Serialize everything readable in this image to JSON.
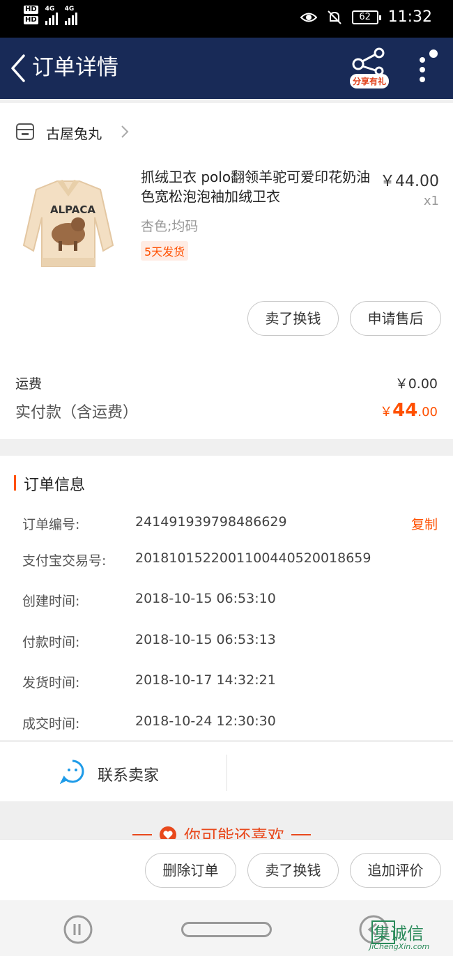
{
  "statusbar": {
    "hd1": "HD",
    "hd2": "HD",
    "net1": "4G",
    "net2": "4G",
    "battery": "62",
    "time": "11:32"
  },
  "header": {
    "title": "订单详情",
    "share_badge": "分享有礼"
  },
  "shop": {
    "name": "古屋兔丸"
  },
  "product": {
    "title": "抓绒卫衣 polo翻领羊驼可爱印花奶油色宽松泡泡袖加绒卫衣",
    "price": "￥44.00",
    "qty": "x1",
    "sku": "杏色;均码",
    "ship_tag": "5天发货",
    "print_text": "ALPACA",
    "buttons": [
      "卖了换钱",
      "申请售后"
    ]
  },
  "fees": {
    "freight_label": "运费",
    "freight_value": "￥0.00",
    "total_label": "实付款（含运费）",
    "total_symbol": "￥",
    "total_int": "44",
    "total_dec": ".00"
  },
  "order_info": {
    "title": "订单信息",
    "copy_label": "复制",
    "rows": [
      {
        "label": "订单编号:",
        "value": "241491939798486629"
      },
      {
        "label": "支付宝交易号:",
        "value": "2018101522001100440520018659"
      },
      {
        "label": "创建时间:",
        "value": "2018-10-15 06:53:10"
      },
      {
        "label": "付款时间:",
        "value": "2018-10-15 06:53:13"
      },
      {
        "label": "发货时间:",
        "value": "2018-10-17 14:32:21"
      },
      {
        "label": "成交时间:",
        "value": "2018-10-24 12:30:30"
      }
    ]
  },
  "contact": {
    "label": "联系卖家"
  },
  "teaser": {
    "text": "你可能还喜欢"
  },
  "actions": {
    "buttons": [
      "删除订单",
      "卖了换钱",
      "追加评价"
    ]
  },
  "watermark": {
    "chars": "集诚信",
    "url": "JiChengXin.com"
  },
  "colors": {
    "header_bg": "#182a57",
    "accent": "#ff5000"
  }
}
